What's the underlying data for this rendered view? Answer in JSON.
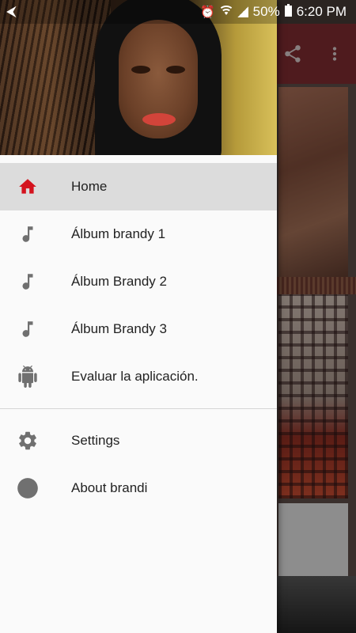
{
  "status_bar": {
    "battery": "50%",
    "time": "6:20 PM"
  },
  "menu": {
    "items": [
      {
        "label": "Home",
        "icon": "home-icon"
      },
      {
        "label": "Álbum brandy 1",
        "icon": "music-note-icon"
      },
      {
        "label": "Álbum Brandy 2",
        "icon": "music-note-icon"
      },
      {
        "label": "Álbum Brandy 3",
        "icon": "music-note-icon"
      },
      {
        "label": "Evaluar la aplicación.",
        "icon": "android-icon"
      }
    ],
    "secondary": [
      {
        "label": "Settings",
        "icon": "gear-icon"
      },
      {
        "label": "About brandi",
        "icon": "help-icon"
      }
    ]
  },
  "colors": {
    "accent": "#d4131e",
    "toolbar": "#7a2a2e",
    "active_row": "#dcdcdc"
  }
}
